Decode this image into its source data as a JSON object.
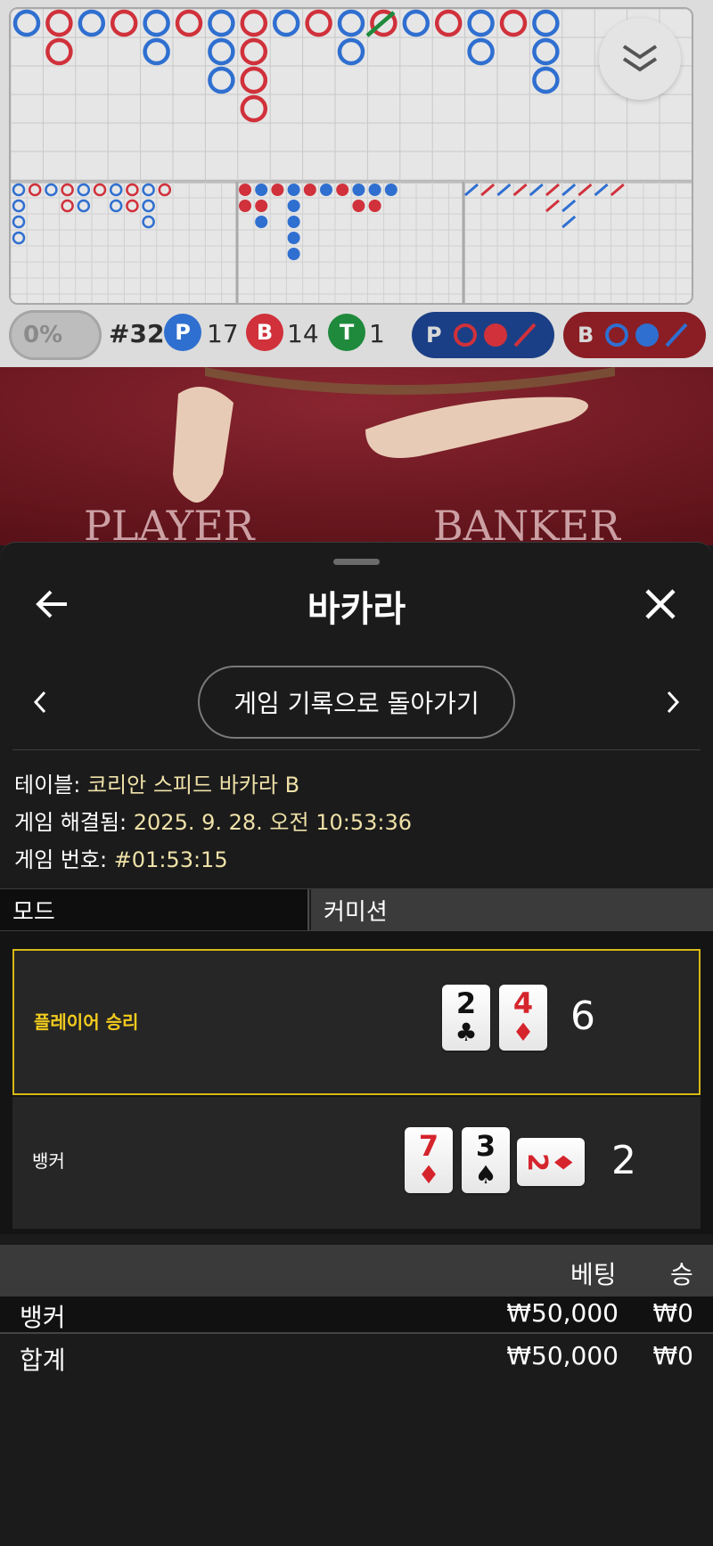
{
  "roadmap": {
    "percent": "0%",
    "round": "#32",
    "player": {
      "letter": "P",
      "count": "17"
    },
    "banker": {
      "letter": "B",
      "count": "14"
    },
    "tie": {
      "letter": "T",
      "count": "1"
    },
    "player_predict_letter": "P",
    "banker_predict_letter": "B",
    "colors": {
      "player": "#2f6fd0",
      "banker": "#d0313b",
      "tie": "#1f8a3c"
    }
  },
  "video": {
    "player_label": "PLAYER",
    "banker_label": "BANKER"
  },
  "panel": {
    "title": "바카라",
    "back_to_history": "게임 기록으로 돌아가기",
    "table_label": "테이블:",
    "table_value": "코리안 스피드 바카라 B",
    "resolved_label": "게임 해결됨:",
    "resolved_value": "2025. 9. 28. 오전 10:53:36",
    "number_label": "게임 번호:",
    "number_value": "#01:53:15",
    "tabs": [
      "모드",
      "커미션"
    ],
    "player_result": {
      "label": "플레이어 승리",
      "cards": [
        {
          "rank": "2",
          "suit": "♣",
          "color": "black"
        },
        {
          "rank": "4",
          "suit": "♦",
          "color": "red"
        }
      ],
      "score": "6"
    },
    "banker_result": {
      "label": "뱅커",
      "cards": [
        {
          "rank": "7",
          "suit": "♦",
          "color": "red"
        },
        {
          "rank": "3",
          "suit": "♠",
          "color": "black"
        },
        {
          "rank": "2",
          "suit": "♦",
          "color": "red"
        }
      ],
      "score": "2"
    },
    "bets": {
      "head_bet": "베팅",
      "head_win": "승",
      "rows": [
        {
          "name": "뱅커",
          "bet": "₩50,000",
          "win": "₩0"
        },
        {
          "name": "합계",
          "bet": "₩50,000",
          "win": "₩0"
        }
      ]
    }
  }
}
